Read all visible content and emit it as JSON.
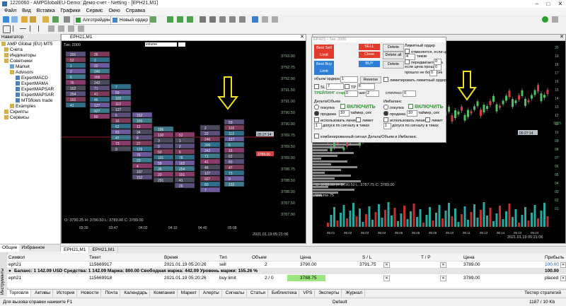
{
  "window": {
    "title": "1220060 - AMPGlobalEU-Demo: Демо-счет - Netting - [EPH21,M1]"
  },
  "menu": [
    "Файл",
    "Вид",
    "Вставка",
    "Графики",
    "Сервис",
    "Окно",
    "Справка"
  ],
  "toolbar": {
    "algo_label": "Алготрейдинг",
    "new_order_label": "Новый ордер"
  },
  "navigator": {
    "header": "Навигатор",
    "items": [
      "AMP Global (EU) MT5",
      "Счета",
      "Индикаторы",
      "Советники",
      "Market",
      "Advisors",
      "ExpertMACD",
      "ExpertMAMA",
      "ExpertMAPSAR",
      "ExpertMAPSAR",
      "MT5flows trade",
      "Examples",
      "Скрипты",
      "Сервисы"
    ],
    "tabs": [
      "Общие",
      "Избранное"
    ]
  },
  "chart_left": {
    "title": "EPH21,M1",
    "top_left": "Тик: 2000",
    "indicator": "volume",
    "ohlc": "O: 3790.25  H: 3790.50  L: 3789.00  C: 3789.00",
    "times": [
      "03:30",
      "03:47",
      "04:02",
      "04:10",
      "04:40",
      "05:08"
    ],
    "date": "2021.01.19 05:21:06",
    "prices": [
      "3793.00",
      "3792.75",
      "3792.00",
      "3791.50",
      "3791.00",
      "3790.50",
      "3790.00",
      "3789.75",
      "3789.50",
      "3789.00",
      "3788.75",
      "3788.50",
      "3788.00",
      "3787.50",
      "3787.00"
    ],
    "bid_label": "3789.00",
    "ask_label": "05:27:14",
    "cluster_numbers": [
      "291",
      "52",
      "1",
      "2",
      "6",
      "76",
      "162",
      "254",
      "151",
      "41",
      "26",
      "2",
      "22",
      "246",
      "306",
      "242",
      "71",
      "41",
      "46",
      "127",
      "927",
      "80",
      "7",
      "59",
      "102",
      "112",
      "127",
      "6",
      "16",
      "62",
      "83",
      "47",
      "73",
      "9",
      "152",
      "165",
      "12",
      "34",
      "8",
      "27",
      "129",
      "76",
      "23",
      "4",
      "107",
      "152",
      "186",
      "130",
      "3",
      "9",
      "50",
      "101",
      "58",
      "36",
      "20"
    ]
  },
  "trade_panel": {
    "title": "EPH21 - Тик: 2000",
    "best_sell": "Best Sell Limit 3789.0",
    "sell": "SELL",
    "delete": "Delete",
    "close": "Close",
    "delete_all": "Delete all",
    "best_buy": "Best Buy Limit 3789.0",
    "buy": "BUY",
    "reverse": "Reverse",
    "volume_label": "объем ордера",
    "volume_value": "1",
    "sl_label": "SL",
    "sl_value": "7",
    "tp_label": "TP",
    "tp_value": "6",
    "trailing_label": "ТРЕЙЛИНГ старт",
    "trailing_start": "0",
    "trailing_step_label": "шаг",
    "trailing_step": "2",
    "stoploss_label": "стоплосс",
    "stoploss_value": "0",
    "limit_order_label": "Лимитный ордер",
    "limit_opt1": "отменяется, если цена ушла на",
    "limit_opt1_val": "4",
    "limit_opt1_unit": "тиков",
    "limit_opt2": "передвигается на",
    "limit_opt2_val": "0",
    "limit_opt2_unit": "тиков",
    "limit_opt3": "если цена прошла",
    "limit_opt3_val": "0",
    "limit_opt3_unit": "тиков и",
    "limit_opt4": "прошло не более",
    "limit_opt4_val": "0",
    "limit_opt4_unit": "сек",
    "limit_opt5": "лимитировать лимитный ордером",
    "delta_header": "Дельта/Объем",
    "delta_on": "ВКЛЮЧИТЬ",
    "delta_buy": "покупка",
    "delta_buy_val": "10",
    "delta_timer_label": "таймер, сек",
    "delta_sell": "продажа",
    "delta_sell_val": "10",
    "delta_line": "использовать линию",
    "delta_limit": "лимит",
    "delta_tick_label": "допуск по сигналу в тиках",
    "delta_tick_val": "1",
    "imb_header": "Имбаланс",
    "imb_on": "ВКЛЮЧИТЬ",
    "imb_buy": "покупка",
    "imb_buy_val": "10",
    "imb_timer_label": "таймер, сек",
    "imb_sell": "продажа",
    "imb_sell_val": "10",
    "imb_line": "использовать линию",
    "imb_limit": "лимит",
    "imb_tick_label": "допуск по сигналу в тиках",
    "imb_tick_val": "1",
    "combined": "комбинированный сигнал Дельта/Объем и Имбаланс"
  },
  "chart_right": {
    "volume_label": "Volume 75",
    "ohlc": "O: 3788.50  H: 3790.50  L: 3787.75  C: 3789.00",
    "times": [
      "05:01",
      "05:02",
      "05:03",
      "05:04",
      "05:05",
      "05:06",
      "05:09",
      "05:10",
      "05:11",
      "05:13",
      "05:14",
      "05:23",
      "05:24"
    ],
    "date": "2021.01.19 05:21:06",
    "price_labels": [
      "20",
      "19",
      "18",
      "17",
      "16",
      "15",
      "14",
      "13",
      "12",
      "11",
      "10",
      "09",
      "08",
      "07",
      "06",
      "05",
      "04",
      "03",
      "02",
      "01"
    ],
    "highlight_labels": [
      "05:27:14",
      "1665",
      "3789.50",
      "3789.00"
    ]
  },
  "chart_tabs": [
    "EPH21,M1",
    "EPH21,M1"
  ],
  "orders_table": {
    "headers": [
      "Символ",
      "Тикет",
      "Время",
      "Тип",
      "Объем",
      "Цена",
      "S / L",
      "T / P",
      "Цена",
      "Прибыль"
    ],
    "rows": [
      [
        "eph21",
        "115669917",
        "2021.01.19 05:20:26",
        "sell",
        "2",
        "3790.00",
        "3791.75",
        "",
        "3789.00",
        "100.00"
      ],
      [
        "eph21",
        "115669918",
        "2021.01.19 05:20:26",
        "buy limit",
        "2 / 0",
        "3788.75",
        "",
        "",
        "3789.00",
        "placed"
      ]
    ],
    "balance": "Баланс: 1 142.09 USD  Средства: 1 142.09  Маржа: 800.00  Свободная маржа: 442.09  Уровень маржи: 155.26 %",
    "balance_profit": "100.00"
  },
  "bottom_tabs": [
    "Торговля",
    "Активы",
    "История",
    "Новости",
    "Почта",
    "Календарь",
    "Компания",
    "Маркет",
    "Алерты",
    "Сигналы",
    "Статьи",
    "Библиотека",
    "VPS",
    "Эксперты",
    "Журнал"
  ],
  "toolbox_label": "Инструменты",
  "tester_label": "Тестер стратегий",
  "status": {
    "help": "Для вызова справки нажмите F1",
    "profile": "Default",
    "traffic": "1187 / 10 Kb"
  }
}
